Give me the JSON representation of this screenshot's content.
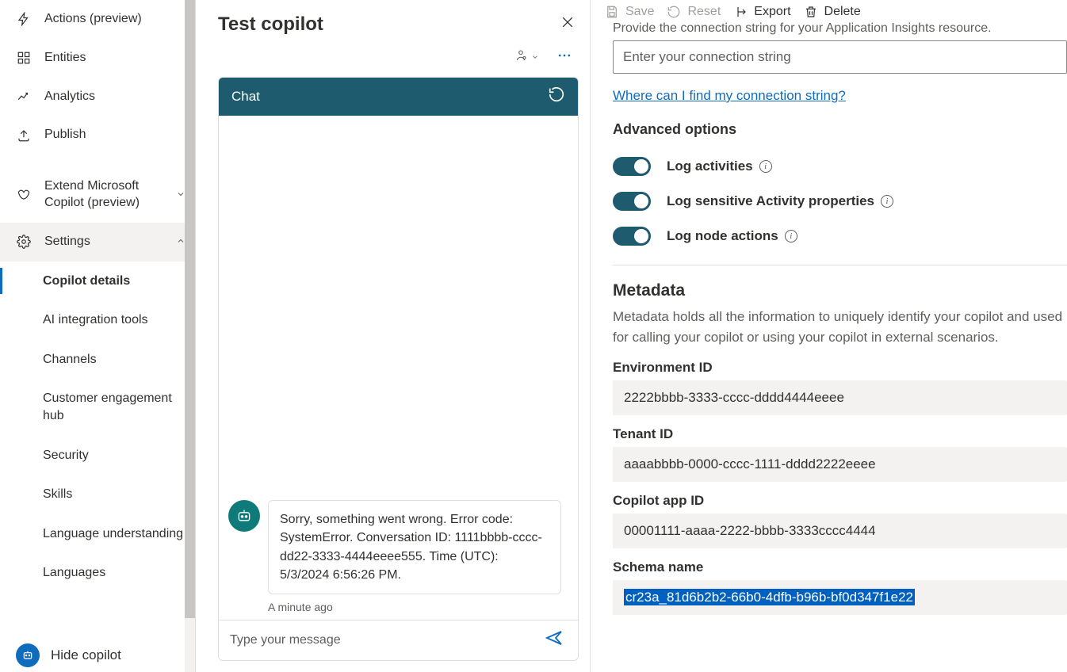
{
  "sidebar": {
    "items": {
      "actions": "Actions (preview)",
      "entities": "Entities",
      "analytics": "Analytics",
      "publish": "Publish",
      "extend": "Extend Microsoft Copilot (preview)",
      "settings": "Settings"
    },
    "settings_children": {
      "copilot_details": "Copilot details",
      "ai_integration": "AI integration tools",
      "channels": "Channels",
      "engagement_hub": "Customer engagement hub",
      "security": "Security",
      "skills": "Skills",
      "lang_understanding": "Language understanding",
      "languages": "Languages"
    },
    "hide_copilot": "Hide copilot"
  },
  "test_panel": {
    "title": "Test copilot",
    "chat_header": "Chat",
    "bot_message": "Sorry, something went wrong. Error code: SystemError. Conversation ID: 1111bbbb-cccc-dd22-3333-4444eeee555. Time (UTC): 5/3/2024 6:56:26 PM.",
    "timestamp": "A minute ago",
    "input_placeholder": "Type your message"
  },
  "toolbar": {
    "save": "Save",
    "reset": "Reset",
    "export": "Export",
    "delete": "Delete"
  },
  "details": {
    "cut_help": "Provide the connection string for your Application Insights resource.",
    "conn_placeholder": "Enter your connection string",
    "conn_link": "Where can I find my connection string?",
    "adv_heading": "Advanced options",
    "toggles": {
      "log_activities": "Log activities",
      "log_sensitive": "Log sensitive Activity properties",
      "log_node": "Log node actions"
    },
    "metadata_heading": "Metadata",
    "metadata_desc": "Metadata holds all the information to uniquely identify your copilot and used for calling your copilot or using your copilot in external scenarios.",
    "fields": {
      "env_label": "Environment ID",
      "env_value": "2222bbbb-3333-cccc-dddd4444eeee",
      "tenant_label": "Tenant ID",
      "tenant_value": "aaaabbbb-0000-cccc-1111-dddd2222eeee",
      "app_label": "Copilot app ID",
      "app_value": "00001111-aaaa-2222-bbbb-3333cccc4444",
      "schema_label": "Schema name",
      "schema_value": "cr23a_81d6b2b2-66b0-4dfb-b96b-bf0d347f1e22"
    }
  }
}
